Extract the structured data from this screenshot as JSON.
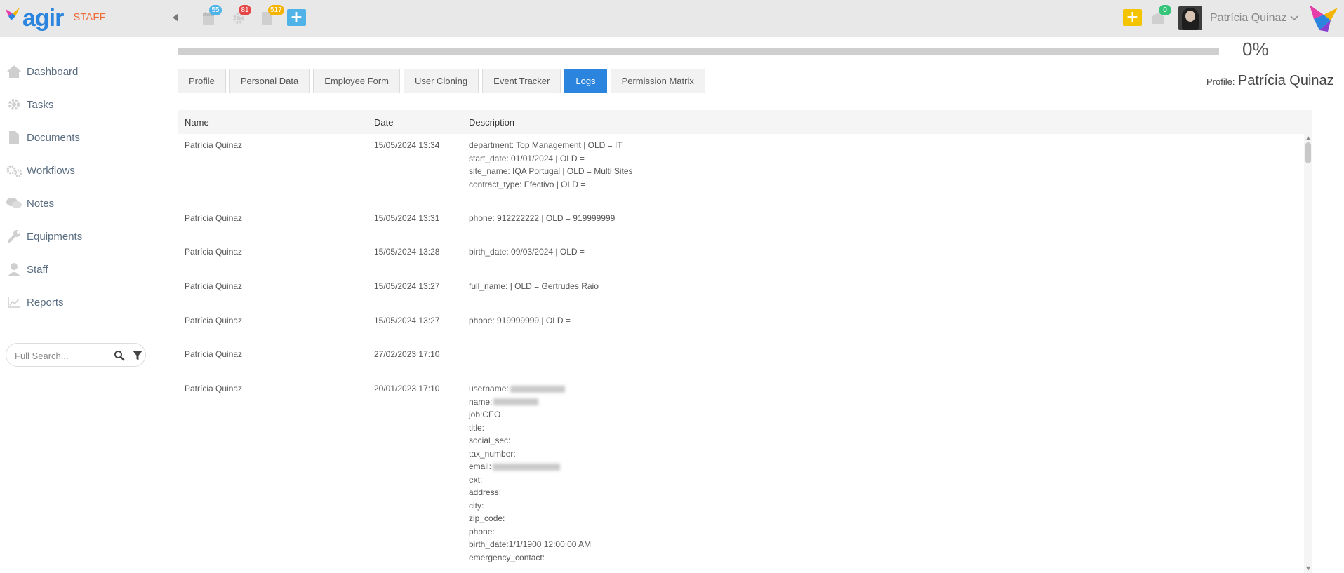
{
  "app": {
    "logo_text": "agir",
    "module": "STAFF"
  },
  "header": {
    "calendar_badge": "55",
    "gear_badge": "81",
    "doc_badge": "517",
    "inbox_badge": "0",
    "user_name": "Patrícia Quinaz",
    "colors": {
      "badge_calendar": "#4fb3e8",
      "badge_gear": "#e64545",
      "badge_doc": "#f5b400",
      "badge_inbox": "#35c47a",
      "add_blue": "#4fb3e8",
      "add_yellow": "#f5c400",
      "accent": "#2b85de"
    }
  },
  "sidebar": {
    "items": [
      {
        "label": "Dashboard",
        "icon": "home-icon"
      },
      {
        "label": "Tasks",
        "icon": "gear-icon"
      },
      {
        "label": "Documents",
        "icon": "document-icon"
      },
      {
        "label": "Workflows",
        "icon": "gears-icon"
      },
      {
        "label": "Notes",
        "icon": "comments-icon"
      },
      {
        "label": "Equipments",
        "icon": "wrench-icon"
      },
      {
        "label": "Staff",
        "icon": "user-icon"
      },
      {
        "label": "Reports",
        "icon": "chart-icon"
      }
    ],
    "search_placeholder": "Full Search..."
  },
  "progress": {
    "value": 0,
    "label": "0%"
  },
  "tabs": [
    {
      "label": "Profile",
      "active": false
    },
    {
      "label": "Personal Data",
      "active": false
    },
    {
      "label": "Employee Form",
      "active": false
    },
    {
      "label": "User Cloning",
      "active": false
    },
    {
      "label": "Event Tracker",
      "active": false
    },
    {
      "label": "Logs",
      "active": true
    },
    {
      "label": "Permission Matrix",
      "active": false
    }
  ],
  "profile": {
    "label": "Profile:",
    "name": "Patrícia Quinaz"
  },
  "logs": {
    "columns": [
      "Name",
      "Date",
      "Description"
    ],
    "rows": [
      {
        "name": "Patrícia Quinaz",
        "date": "15/05/2024 13:34",
        "description": [
          "department: Top Management | OLD = IT",
          "start_date: 01/01/2024 | OLD =",
          "site_name: IQA Portugal | OLD = Multi Sites",
          "contract_type: Efectivo | OLD ="
        ]
      },
      {
        "name": "Patrícia Quinaz",
        "date": "15/05/2024 13:31",
        "description": [
          "phone: 912222222 | OLD = 919999999"
        ]
      },
      {
        "name": "Patrícia Quinaz",
        "date": "15/05/2024 13:28",
        "description": [
          "birth_date: 09/03/2024 | OLD ="
        ]
      },
      {
        "name": "Patrícia Quinaz",
        "date": "15/05/2024 13:27",
        "description": [
          "full_name: | OLD = Gertrudes Raio"
        ]
      },
      {
        "name": "Patrícia Quinaz",
        "date": "15/05/2024 13:27",
        "description": [
          "phone: 919999999 | OLD ="
        ]
      },
      {
        "name": "Patrícia Quinaz",
        "date": "27/02/2023 17:10",
        "description": []
      },
      {
        "name": "Patrícia Quinaz",
        "date": "20/01/2023 17:10",
        "description": [
          "username:",
          "name:",
          "job:CEO",
          "title:",
          "social_sec:",
          "tax_number:",
          "email:",
          "ext:",
          "address:",
          "city:",
          "zip_code:",
          "phone:",
          "birth_date:1/1/1900 12:00:00 AM",
          "emergency_contact:"
        ]
      }
    ]
  }
}
